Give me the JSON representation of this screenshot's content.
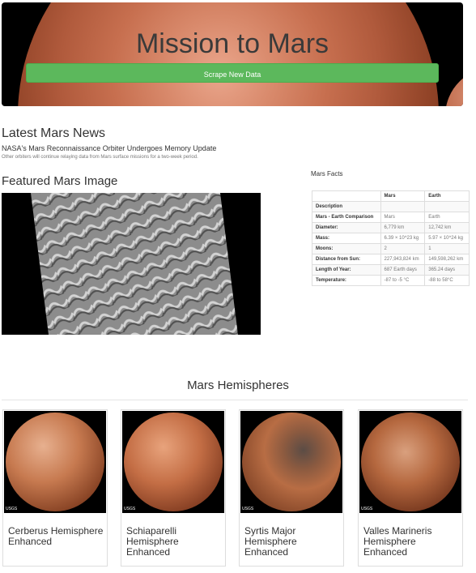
{
  "header": {
    "title": "Mission to Mars",
    "scrape_label": "Scrape New Data"
  },
  "news": {
    "heading": "Latest Mars News",
    "headline": "NASA's Mars Reconnaissance Orbiter Undergoes Memory Update",
    "teaser": "Other orbiters will continue relaying data from Mars surface missions for a two-week period."
  },
  "featured": {
    "heading": "Featured Mars Image"
  },
  "facts": {
    "heading": "Mars Facts",
    "columns": [
      "",
      "Mars",
      "Earth"
    ],
    "rows": [
      [
        "Description",
        "",
        ""
      ],
      [
        "Mars - Earth Comparison",
        "Mars",
        "Earth"
      ],
      [
        "Diameter:",
        "6,779 km",
        "12,742 km"
      ],
      [
        "Mass:",
        "6.39 × 10^23 kg",
        "5.97 × 10^24 kg"
      ],
      [
        "Moons:",
        "2",
        "1"
      ],
      [
        "Distance from Sun:",
        "227,943,824 km",
        "149,598,262 km"
      ],
      [
        "Length of Year:",
        "687 Earth days",
        "365.24 days"
      ],
      [
        "Temperature:",
        "-87 to -5 °C",
        "-88 to 58°C"
      ]
    ]
  },
  "hemispheres": {
    "heading": "Mars Hemispheres",
    "watermark": "USGS",
    "items": [
      {
        "title": "Cerberus Hemisphere Enhanced",
        "color": "#c77a50"
      },
      {
        "title": "Schiaparelli Hemisphere Enhanced",
        "color": "#c46e45"
      },
      {
        "title": "Syrtis Major Hemisphere Enhanced",
        "color": "#b86d44"
      },
      {
        "title": "Valles Marineris Hemisphere Enhanced",
        "color": "#b5683f"
      }
    ]
  }
}
